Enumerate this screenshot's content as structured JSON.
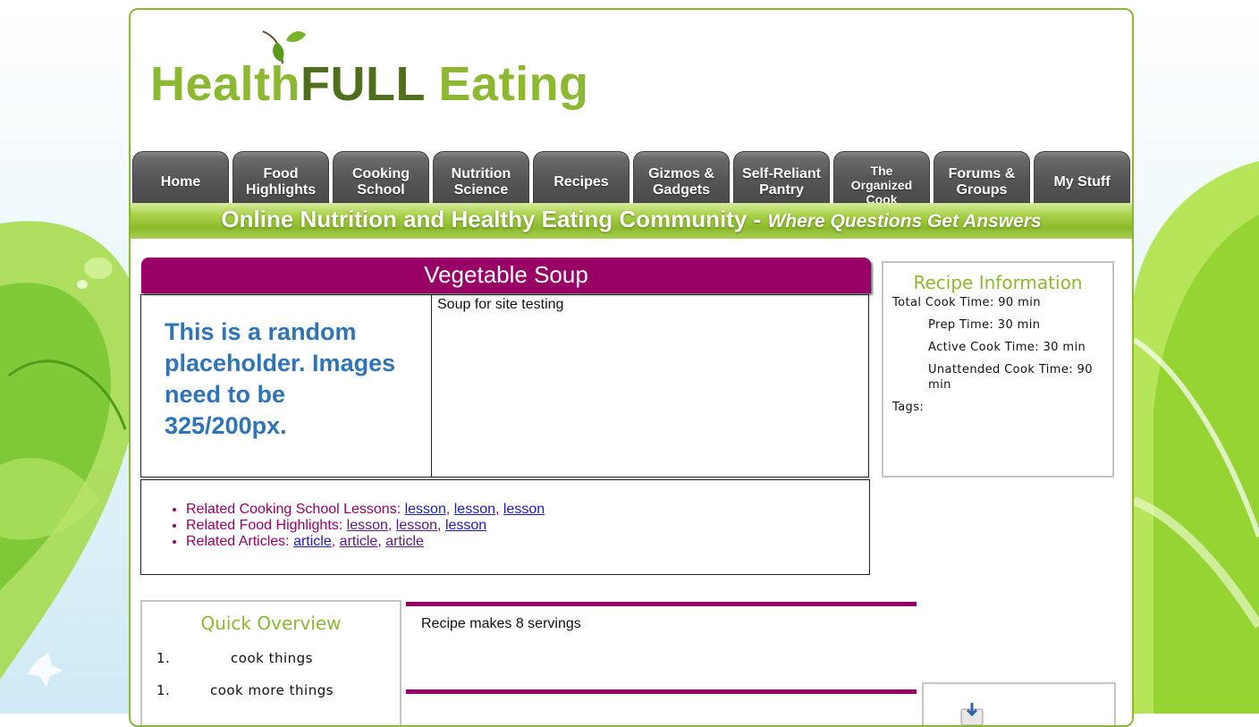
{
  "logo": {
    "part1": "Health",
    "part2": "FULL",
    "part3": " Eating"
  },
  "nav": {
    "tabs": [
      {
        "line1": "Home",
        "line2": ""
      },
      {
        "line1": "Food",
        "line2": "Highlights"
      },
      {
        "line1": "Cooking",
        "line2": "School"
      },
      {
        "line1": "Nutrition",
        "line2": "Science"
      },
      {
        "line1": "Recipes",
        "line2": ""
      },
      {
        "line1": "Gizmos &",
        "line2": "Gadgets"
      },
      {
        "line1": "Self-Reliant",
        "line2": "Pantry"
      },
      {
        "line1": "The",
        "line2": "Organized",
        "line3": "Cook"
      },
      {
        "line1": "Forums &",
        "line2": "Groups"
      },
      {
        "line1": "My Stuff",
        "line2": ""
      }
    ]
  },
  "tagline": {
    "main": "Online Nutrition and Healthy Eating Community - ",
    "emph": "Where Questions Get Answers"
  },
  "recipe": {
    "title": "Vegetable Soup",
    "image_placeholder": "This is a random placeholder. Images need to be 325/200px.",
    "description": "Soup for site testing"
  },
  "related": {
    "lessons_label": "Related Cooking School Lessons: ",
    "lessons": [
      "lesson",
      "lesson",
      "lesson"
    ],
    "highlights_label": "Related Food Highlights: ",
    "highlights": [
      "lesson",
      "lesson",
      "lesson"
    ],
    "articles_label": "Related Articles: ",
    "articles": [
      "article",
      "article",
      "article"
    ],
    "separator": ", "
  },
  "info": {
    "heading": "Recipe Information",
    "total": "Total Cook Time: 90 min",
    "prep": "Prep Time: 30 min",
    "active": "Active Cook Time: 30 min",
    "unattended": "Unattended Cook Time: 90 min",
    "tags": "Tags:"
  },
  "overview": {
    "heading": "Quick Overview",
    "items": [
      {
        "num": "1.",
        "text": "cook things"
      },
      {
        "num": "1.",
        "text": "cook more things"
      }
    ]
  },
  "servings": "Recipe makes 8 servings",
  "colors": {
    "brand_green": "#8cb832",
    "brand_dark_green": "#4f6f1c",
    "accent_purple": "#990066",
    "placeholder_blue": "#2f74b8"
  },
  "icons": {
    "sprig": "leaf-sprig-icon",
    "download": "download-icon"
  }
}
